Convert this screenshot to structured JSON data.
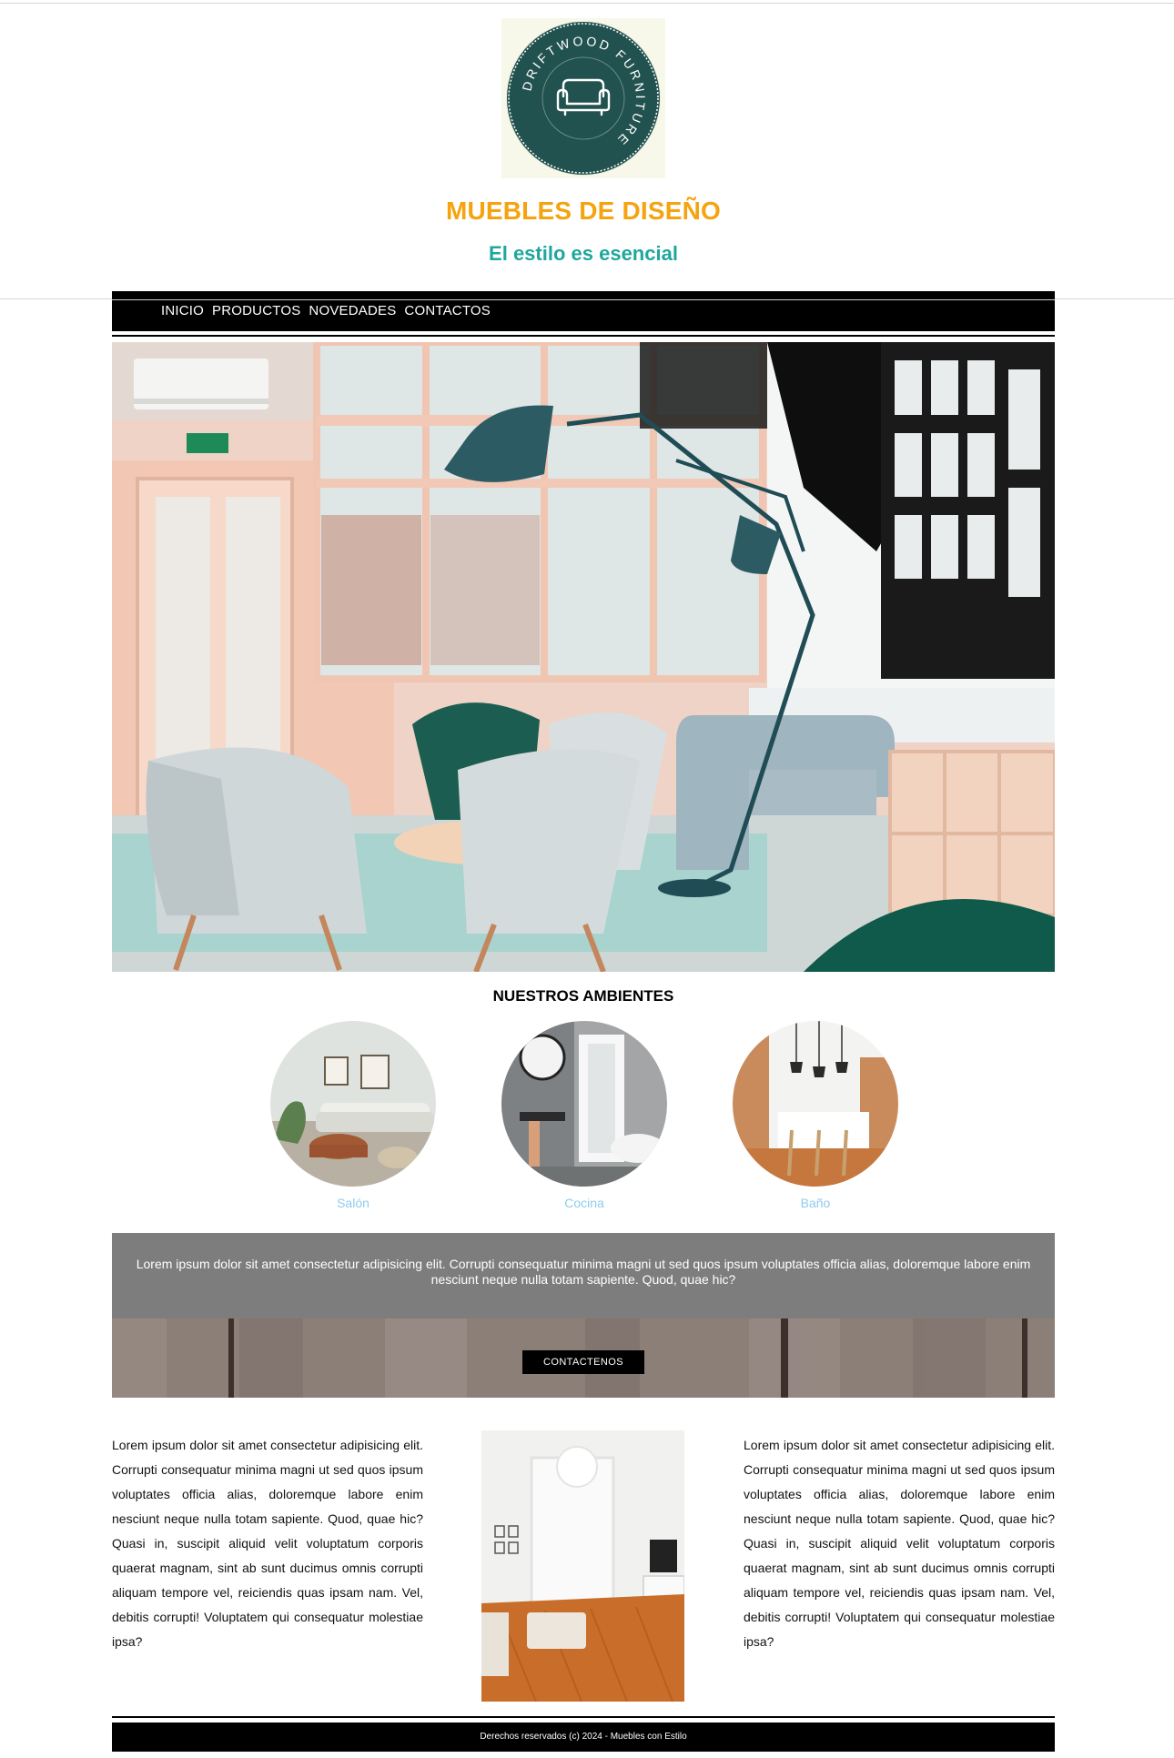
{
  "brand": {
    "logo_text": "DRIFTWOOD FURNITURE",
    "title": "MUEBLES DE DISEÑO",
    "subtitle": "El estilo es esencial"
  },
  "nav": {
    "items": [
      "INICIO",
      "PRODUCTOS",
      "NOVEDADES",
      "CONTACTOS"
    ]
  },
  "ambientes": {
    "title": "NUESTROS AMBIENTES",
    "items": [
      {
        "label": "Salón"
      },
      {
        "label": "Cocina"
      },
      {
        "label": "Baño"
      }
    ]
  },
  "banner": {
    "text": "Lorem ipsum dolor sit amet consectetur adipisicing elit. Corrupti consequatur minima magni ut sed quos ipsum voluptates officia alias, doloremque labore enim nesciunt neque nulla totam sapiente. Quod, quae hic?",
    "button_label": "CONTACTENOS"
  },
  "content": {
    "left_text": "Lorem ipsum dolor sit amet consectetur adipisicing elit. Corrupti consequatur minima magni ut sed quos ipsum voluptates officia alias, doloremque labore enim nesciunt neque nulla totam sapiente. Quod, quae hic? Quasi in, suscipit aliquid velit voluptatum corporis quaerat magnam, sint ab sunt ducimus omnis corrupti aliquam tempore vel, reiciendis quas ipsam nam. Vel, debitis corrupti! Voluptatem qui consequatur molestiae ipsa?",
    "right_text": "Lorem ipsum dolor sit amet consectetur adipisicing elit. Corrupti consequatur minima magni ut sed quos ipsum voluptates officia alias, doloremque labore enim nesciunt neque nulla totam sapiente. Quod, quae hic? Quasi in, suscipit aliquid velit voluptatum corporis quaerat magnam, sint ab sunt ducimus omnis corrupti aliquam tempore vel, reiciendis quas ipsam nam. Vel, debitis corrupti! Voluptatem qui consequatur molestiae ipsa?"
  },
  "footer": {
    "text": "Derechos reservados (c) 2024 - Muebles con Estilo"
  },
  "colors": {
    "title": "#f5a30f",
    "subtitle": "#1ea79c",
    "caption": "#8fcbf0",
    "nav_bg": "#000000",
    "banner_bg": "#7d7d7d"
  },
  "icons": {
    "logo": "sofa-icon"
  }
}
